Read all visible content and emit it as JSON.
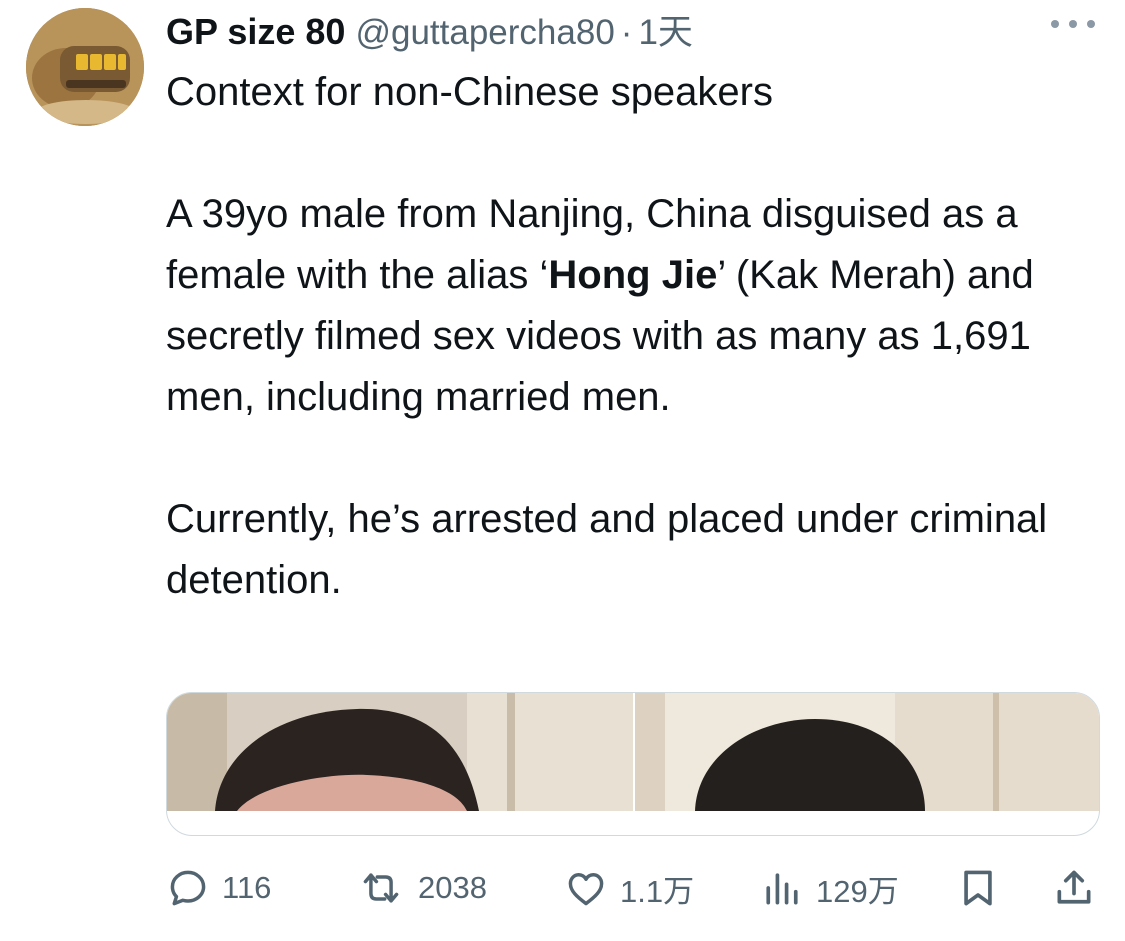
{
  "tweet": {
    "author": {
      "display_name": "GP size 80",
      "handle": "@guttapercha80",
      "time_separator": "·",
      "time": "1天"
    },
    "text": {
      "line1": "Context for non-Chinese speakers",
      "p2_part1": "A 39yo male from Nanjing, China disguised as a female with the alias ‘",
      "p2_bold": "Hong Jie",
      "p2_part2": "’ (Kak Merah) and secretly filmed sex videos with as many as 1,691 men, including married men.",
      "p3": "Currently, he’s arrested and placed under criminal detention."
    },
    "metrics": {
      "replies": "116",
      "retweets": "2038",
      "likes": "1.1万",
      "views": "129万"
    }
  },
  "colors": {
    "text": "#0f1419",
    "secondary": "#536471",
    "border": "#cfd9de"
  },
  "icons": [
    "avatar-image",
    "more-icon",
    "reply-icon",
    "retweet-icon",
    "like-icon",
    "views-icon",
    "bookmark-icon",
    "share-icon"
  ]
}
